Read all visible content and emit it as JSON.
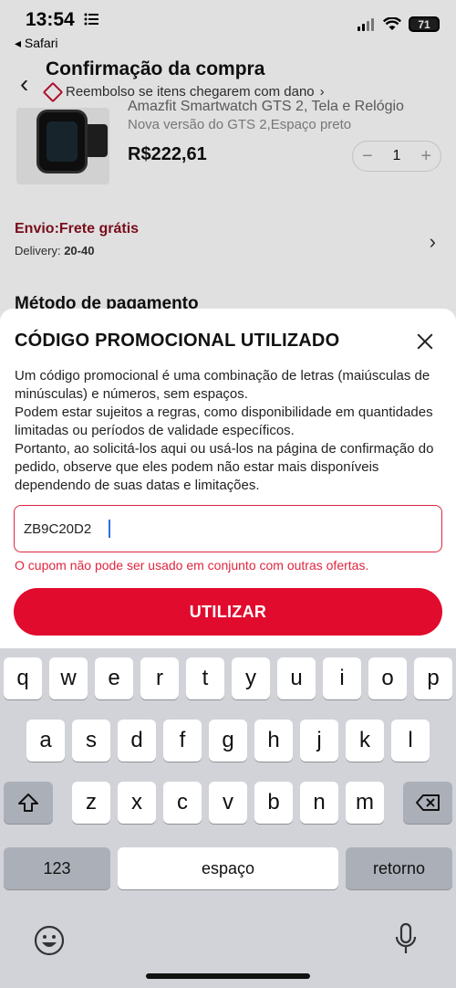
{
  "status_bar": {
    "time": "13:54",
    "back_app": "◂ Safari",
    "battery": "71"
  },
  "header": {
    "title": "Confirmação da compra",
    "subtitle": "Reembolso se itens chegarem com dano",
    "subtitle_chevron": "›",
    "back": "‹"
  },
  "product": {
    "title": "Amazfit Smartwatch GTS 2, Tela e Relógio",
    "variant": "Nova versão do GTS 2,Espaço preto",
    "price": "R$222,61",
    "qty_minus": "−",
    "quantity": "1",
    "qty_plus": "+"
  },
  "shipping": {
    "title": "Envio:Frete grátis",
    "delivery_label": "Delivery:",
    "delivery_value": "20-40",
    "chevron": "›"
  },
  "payment": {
    "title": "Método de pagamento"
  },
  "promo": {
    "title": "CÓDIGO PROMOCIONAL UTILIZADO",
    "desc1": "Um código promocional é uma combinação de letras (maiúsculas de minúsculas) e números, sem espaços.",
    "desc2": "Podem estar sujeitos a regras, como disponibilidade em quantidades limitadas ou períodos de validade específicos.",
    "desc3": "Portanto, ao solicitá-los aqui ou usá-los na página de confirmação do pedido, observe que eles podem não estar mais disponíveis dependendo de suas datas e limitações.",
    "code_value": "ZB9C20D2",
    "error": "O cupom não pode ser usado em conjunto com outras ofertas.",
    "button": "UTILIZAR"
  },
  "keyboard": {
    "row1": [
      "q",
      "w",
      "e",
      "r",
      "t",
      "y",
      "u",
      "i",
      "o",
      "p"
    ],
    "row2": [
      "a",
      "s",
      "d",
      "f",
      "g",
      "h",
      "j",
      "k",
      "l"
    ],
    "row3": [
      "z",
      "x",
      "c",
      "v",
      "b",
      "n",
      "m"
    ],
    "numbers": "123",
    "space": "espaço",
    "return": "retorno"
  },
  "colors": {
    "accent": "#e10b2e",
    "error": "#e0253f",
    "shipping": "#8a1020"
  }
}
